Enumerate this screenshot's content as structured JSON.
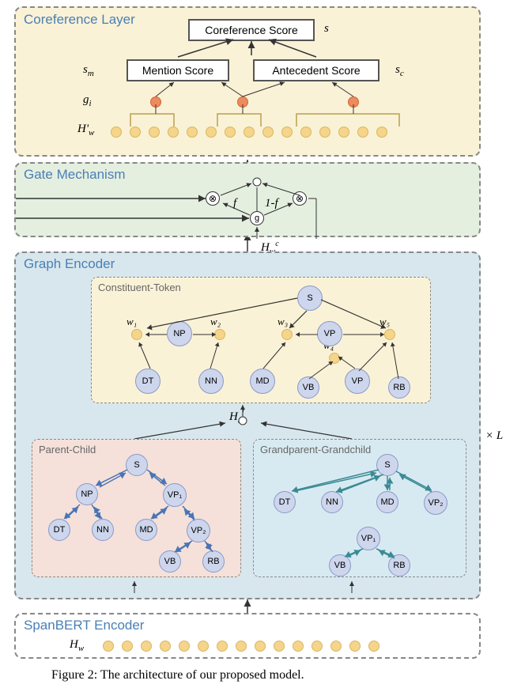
{
  "figure_caption": "Figure 2: The architecture of our proposed model.",
  "coref_layer": {
    "title": "Coreference Layer",
    "coref_score": "Coreference Score",
    "mention_score": "Mention Score",
    "antecedent_score": "Antecedent Score",
    "s": "s",
    "sm": "sₘ",
    "sc": "s_c",
    "gi": "gᵢ",
    "Hwprime": "H'_w"
  },
  "gate": {
    "title": "Gate Mechanism",
    "f": "f",
    "one_minus_f": "1-f",
    "g": "g"
  },
  "graph_encoder": {
    "title": "Graph Encoder",
    "constituent_token": "Constituent-Token",
    "parent_child": "Parent-Child",
    "grandparent": "Grandparent-Grandchild",
    "Hcl": "H^l_c",
    "Hcw": "H^c_w",
    "xL": "× L",
    "words": [
      "w₁",
      "w₂",
      "w₃",
      "w₄",
      "w₅"
    ],
    "pos": {
      "S": "S",
      "NP": "NP",
      "VP": "VP",
      "VP1": "VP₁",
      "VP2": "VP₂",
      "DT": "DT",
      "NN": "NN",
      "MD": "MD",
      "VB": "VB",
      "RB": "RB"
    }
  },
  "spanbert": {
    "title": "SpanBERT Encoder",
    "Hw": "H_w"
  }
}
